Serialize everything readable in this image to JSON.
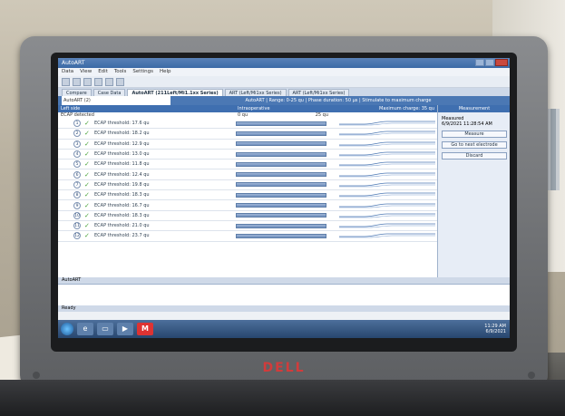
{
  "window": {
    "title": "AutoART",
    "menu": [
      "Data",
      "View",
      "Edit",
      "Tools",
      "Settings",
      "Help"
    ],
    "tabs": [
      {
        "label": "Compare"
      },
      {
        "label": "Case Data"
      },
      {
        "label": "AutoART (211Left/Mi1.1xx Series)",
        "active": true
      },
      {
        "label": "ART (Left/Mi1xx Series)"
      },
      {
        "label": "ART (Left/Mi1xx Series)"
      }
    ]
  },
  "infobar": {
    "field": "AutoART (2)",
    "text": "AutoART | Range: 0-25 qu | Phase duration: 50 µs | Stimulate to maximum charge"
  },
  "main": {
    "left_header": "Left side",
    "mid_header": "Intraoperative",
    "right_header": "Maximum charge: 35 qu",
    "subheader": "ECAP detected",
    "scale_min": "0 qu",
    "scale_max": "25 qu",
    "rows": [
      {
        "n": "1",
        "label": "ECAP threshold: 17.6 qu"
      },
      {
        "n": "2",
        "label": "ECAP threshold: 18.2 qu"
      },
      {
        "n": "3",
        "label": "ECAP threshold: 12.9 qu"
      },
      {
        "n": "4",
        "label": "ECAP threshold: 13.0 qu"
      },
      {
        "n": "5",
        "label": "ECAP threshold: 11.8 qu"
      },
      {
        "n": "6",
        "label": "ECAP threshold: 12.4 qu"
      },
      {
        "n": "7",
        "label": "ECAP threshold: 19.8 qu"
      },
      {
        "n": "8",
        "label": "ECAP threshold: 18.3 qu"
      },
      {
        "n": "9",
        "label": "ECAP threshold: 16.7 qu"
      },
      {
        "n": "10",
        "label": "ECAP threshold: 18.3 qu"
      },
      {
        "n": "11",
        "label": "ECAP threshold: 21.0 qu"
      },
      {
        "n": "12",
        "label": "ECAP threshold: 23.7 qu"
      }
    ]
  },
  "side": {
    "header": "Measurement",
    "measured_label": "Measured",
    "measured_time": "6/9/2021 11:28:54 AM",
    "buttons": [
      "Measure",
      "Go to next electrode",
      "Discard"
    ]
  },
  "status": {
    "bottom_label": "AutoART",
    "ready": "Ready"
  },
  "taskbar": {
    "time": "11:29 AM",
    "date": "6/9/2021",
    "m_icon": "M"
  },
  "brand": "DELL"
}
